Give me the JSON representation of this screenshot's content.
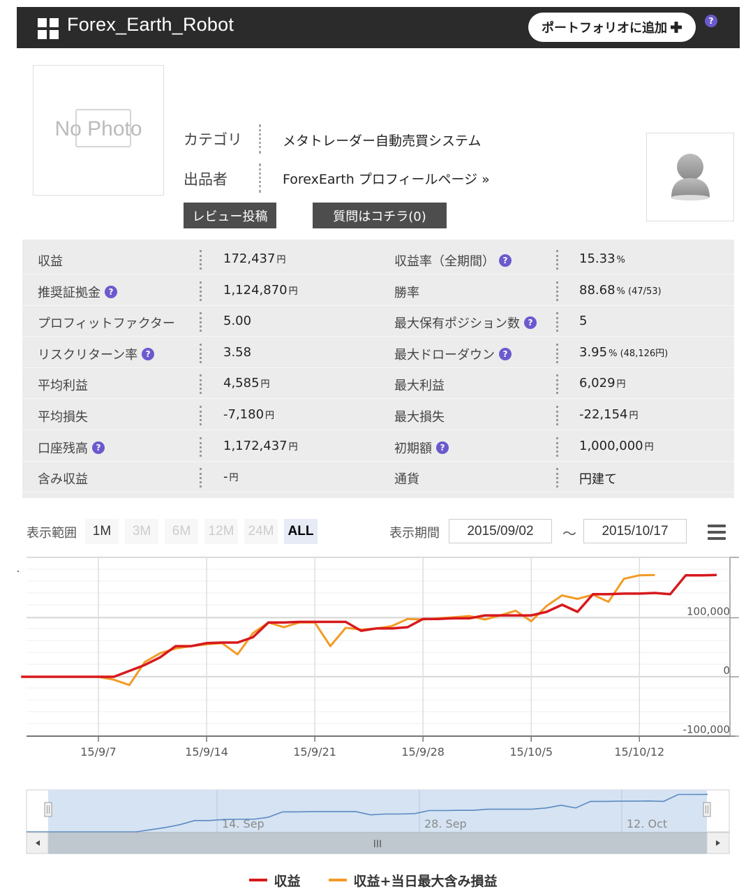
{
  "header": {
    "title": "Forex_Earth_Robot",
    "add_portfolio_label": "ポートフォリオに追加",
    "help_glyph": "?"
  },
  "product": {
    "photo_placeholder": "No Photo",
    "category_label": "カテゴリ",
    "category_value": "メタトレーダー自動売買システム",
    "seller_label": "出品者",
    "seller_value": "ForexEarth プロフィールページ »",
    "review_button": "レビュー投稿",
    "question_button": "質問はコチラ(0)"
  },
  "stats": {
    "left": [
      {
        "label": "収益",
        "value": "172,437",
        "unit": "円",
        "extra": "",
        "help": false
      },
      {
        "label": "推奨証拠金",
        "value": "1,124,870",
        "unit": "円",
        "extra": "",
        "help": true
      },
      {
        "label": "プロフィットファクター",
        "value": "5.00",
        "unit": "",
        "extra": "",
        "help": false
      },
      {
        "label": "リスクリターン率",
        "value": "3.58",
        "unit": "",
        "extra": "",
        "help": true
      },
      {
        "label": "平均利益",
        "value": "4,585",
        "unit": "円",
        "extra": "",
        "help": false
      },
      {
        "label": "平均損失",
        "value": "-7,180",
        "unit": "円",
        "extra": "",
        "help": false
      },
      {
        "label": "口座残高",
        "value": "1,172,437",
        "unit": "円",
        "extra": "",
        "help": true
      },
      {
        "label": "含み収益",
        "value": "-",
        "unit": "円",
        "extra": "",
        "help": false
      }
    ],
    "right": [
      {
        "label": "収益率（全期間）",
        "value": "15.33",
        "unit": "%",
        "extra": "",
        "help": true
      },
      {
        "label": "勝率",
        "value": "88.68",
        "unit": "%",
        "extra": " (47/53)",
        "help": false
      },
      {
        "label": "最大保有ポジション数",
        "value": "5",
        "unit": "",
        "extra": "",
        "help": true
      },
      {
        "label": "最大ドローダウン",
        "value": "3.95",
        "unit": "%",
        "extra": " (48,126円)",
        "help": true
      },
      {
        "label": "最大利益",
        "value": "6,029",
        "unit": "円",
        "extra": "",
        "help": false
      },
      {
        "label": "最大損失",
        "value": "-22,154",
        "unit": "円",
        "extra": "",
        "help": false
      },
      {
        "label": "初期額",
        "value": "1,000,000",
        "unit": "円",
        "extra": "",
        "help": true
      },
      {
        "label": "通貨",
        "value": "円建て",
        "unit": "",
        "extra": "",
        "help": false
      }
    ]
  },
  "range": {
    "label": "表示範囲",
    "buttons": [
      {
        "label": "1M",
        "state": "enabled"
      },
      {
        "label": "3M",
        "state": "disabled"
      },
      {
        "label": "6M",
        "state": "disabled"
      },
      {
        "label": "12M",
        "state": "disabled"
      },
      {
        "label": "24M",
        "state": "disabled"
      },
      {
        "label": "ALL",
        "state": "active"
      }
    ],
    "period_label": "表示期間",
    "from": "2015/09/02",
    "tilde": "〜",
    "to": "2015/10/17"
  },
  "chart_data": {
    "type": "line",
    "x_ticks": [
      "15/9/7",
      "15/9/14",
      "15/9/21",
      "15/9/28",
      "15/10/5",
      "15/10/12"
    ],
    "y_ticks": [
      "100,000",
      "0",
      "-100,000"
    ],
    "ylim": [
      -100000,
      200000
    ],
    "x_start": "2015-09-02",
    "series": [
      {
        "name": "収益",
        "color": "#d7191c",
        "points": [
          [
            "2015-09-02",
            0
          ],
          [
            "2015-09-07",
            0
          ],
          [
            "2015-09-08",
            0
          ],
          [
            "2015-09-09",
            10000
          ],
          [
            "2015-09-10",
            20000
          ],
          [
            "2015-09-11",
            33000
          ],
          [
            "2015-09-12",
            52000
          ],
          [
            "2015-09-13",
            52000
          ],
          [
            "2015-09-14",
            57000
          ],
          [
            "2015-09-15",
            58000
          ],
          [
            "2015-09-16",
            58000
          ],
          [
            "2015-09-17",
            67000
          ],
          [
            "2015-09-18",
            92000
          ],
          [
            "2015-09-19",
            92000
          ],
          [
            "2015-09-20",
            93000
          ],
          [
            "2015-09-21",
            93000
          ],
          [
            "2015-09-22",
            93000
          ],
          [
            "2015-09-23",
            93000
          ],
          [
            "2015-09-24",
            78000
          ],
          [
            "2015-09-25",
            82000
          ],
          [
            "2015-09-26",
            82000
          ],
          [
            "2015-09-27",
            84000
          ],
          [
            "2015-09-28",
            98000
          ],
          [
            "2015-09-29",
            98000
          ],
          [
            "2015-09-30",
            99000
          ],
          [
            "2015-10-01",
            99000
          ],
          [
            "2015-10-02",
            104000
          ],
          [
            "2015-10-03",
            104000
          ],
          [
            "2015-10-04",
            104000
          ],
          [
            "2015-10-05",
            104000
          ],
          [
            "2015-10-06",
            110000
          ],
          [
            "2015-10-07",
            122000
          ],
          [
            "2015-10-08",
            110000
          ],
          [
            "2015-10-09",
            140000
          ],
          [
            "2015-10-10",
            140000
          ],
          [
            "2015-10-11",
            141000
          ],
          [
            "2015-10-12",
            141000
          ],
          [
            "2015-10-13",
            142000
          ],
          [
            "2015-10-14",
            140000
          ],
          [
            "2015-10-15",
            172000
          ],
          [
            "2015-10-16",
            172000
          ],
          [
            "2015-10-17",
            172437
          ]
        ]
      },
      {
        "name": "収益+当日最大含み損益",
        "color": "#f29b26",
        "points": [
          [
            "2015-09-02",
            0
          ],
          [
            "2015-09-07",
            0
          ],
          [
            "2015-09-08",
            -5000
          ],
          [
            "2015-09-09",
            -14000
          ],
          [
            "2015-09-10",
            25000
          ],
          [
            "2015-09-11",
            40000
          ],
          [
            "2015-09-12",
            48000
          ],
          [
            "2015-09-13",
            52000
          ],
          [
            "2015-09-14",
            55000
          ],
          [
            "2015-09-15",
            57000
          ],
          [
            "2015-09-16",
            38000
          ],
          [
            "2015-09-17",
            74000
          ],
          [
            "2015-09-18",
            92000
          ],
          [
            "2015-09-19",
            84000
          ],
          [
            "2015-09-20",
            92000
          ],
          [
            "2015-09-21",
            92000
          ],
          [
            "2015-09-22",
            52000
          ],
          [
            "2015-09-23",
            83000
          ],
          [
            "2015-09-24",
            80000
          ],
          [
            "2015-09-25",
            82000
          ],
          [
            "2015-09-26",
            86000
          ],
          [
            "2015-09-27",
            98000
          ],
          [
            "2015-09-28",
            97000
          ],
          [
            "2015-09-29",
            99000
          ],
          [
            "2015-09-30",
            101000
          ],
          [
            "2015-10-01",
            103000
          ],
          [
            "2015-10-02",
            97000
          ],
          [
            "2015-10-03",
            104000
          ],
          [
            "2015-10-04",
            112000
          ],
          [
            "2015-10-05",
            94000
          ],
          [
            "2015-10-06",
            120000
          ],
          [
            "2015-10-07",
            138000
          ],
          [
            "2015-10-08",
            132000
          ],
          [
            "2015-10-09",
            139000
          ],
          [
            "2015-10-10",
            127000
          ],
          [
            "2015-10-11",
            166000
          ],
          [
            "2015-10-12",
            172000
          ],
          [
            "2015-10-13",
            172437
          ]
        ]
      }
    ],
    "navigator": {
      "labels": [
        "14. Sep",
        "28. Sep",
        "12. Oct"
      ],
      "scroll_glyph": "III"
    }
  },
  "legend": {
    "items": [
      {
        "label": "収益",
        "color": "#d7191c"
      },
      {
        "label": "収益+当日最大含み損益",
        "color": "#f29b26"
      }
    ]
  }
}
